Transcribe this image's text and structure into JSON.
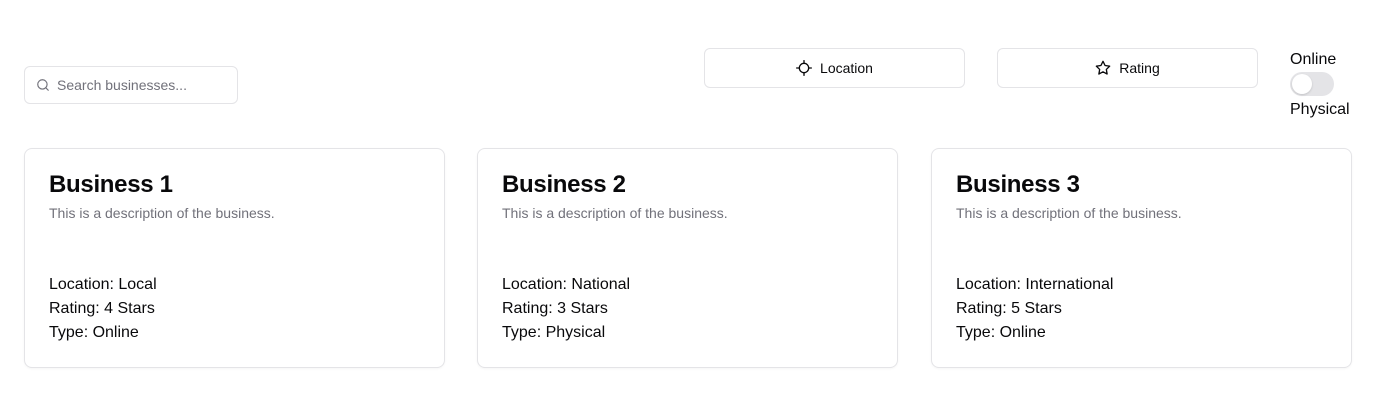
{
  "search": {
    "placeholder": "Search businesses...",
    "icon": "search-icon"
  },
  "filters": {
    "location_label": "Location",
    "location_icon": "crosshair-icon",
    "rating_label": "Rating",
    "rating_icon": "star-icon"
  },
  "type_toggle": {
    "top_label": "Online",
    "bottom_label": "Physical",
    "checked": false
  },
  "businesses": [
    {
      "name": "Business 1",
      "description": "This is a description of the business.",
      "location": "Location: Local",
      "rating": "Rating: 4 Stars",
      "type": "Type: Online"
    },
    {
      "name": "Business 2",
      "description": "This is a description of the business.",
      "location": "Location: National",
      "rating": "Rating: 3 Stars",
      "type": "Type: Physical"
    },
    {
      "name": "Business 3",
      "description": "This is a description of the business.",
      "location": "Location: International",
      "rating": "Rating: 5 Stars",
      "type": "Type: Online"
    }
  ],
  "colors": {
    "border": "#e4e4e7",
    "muted_text": "#71717a",
    "text": "#09090b",
    "switch_off": "#e4e4e7"
  }
}
